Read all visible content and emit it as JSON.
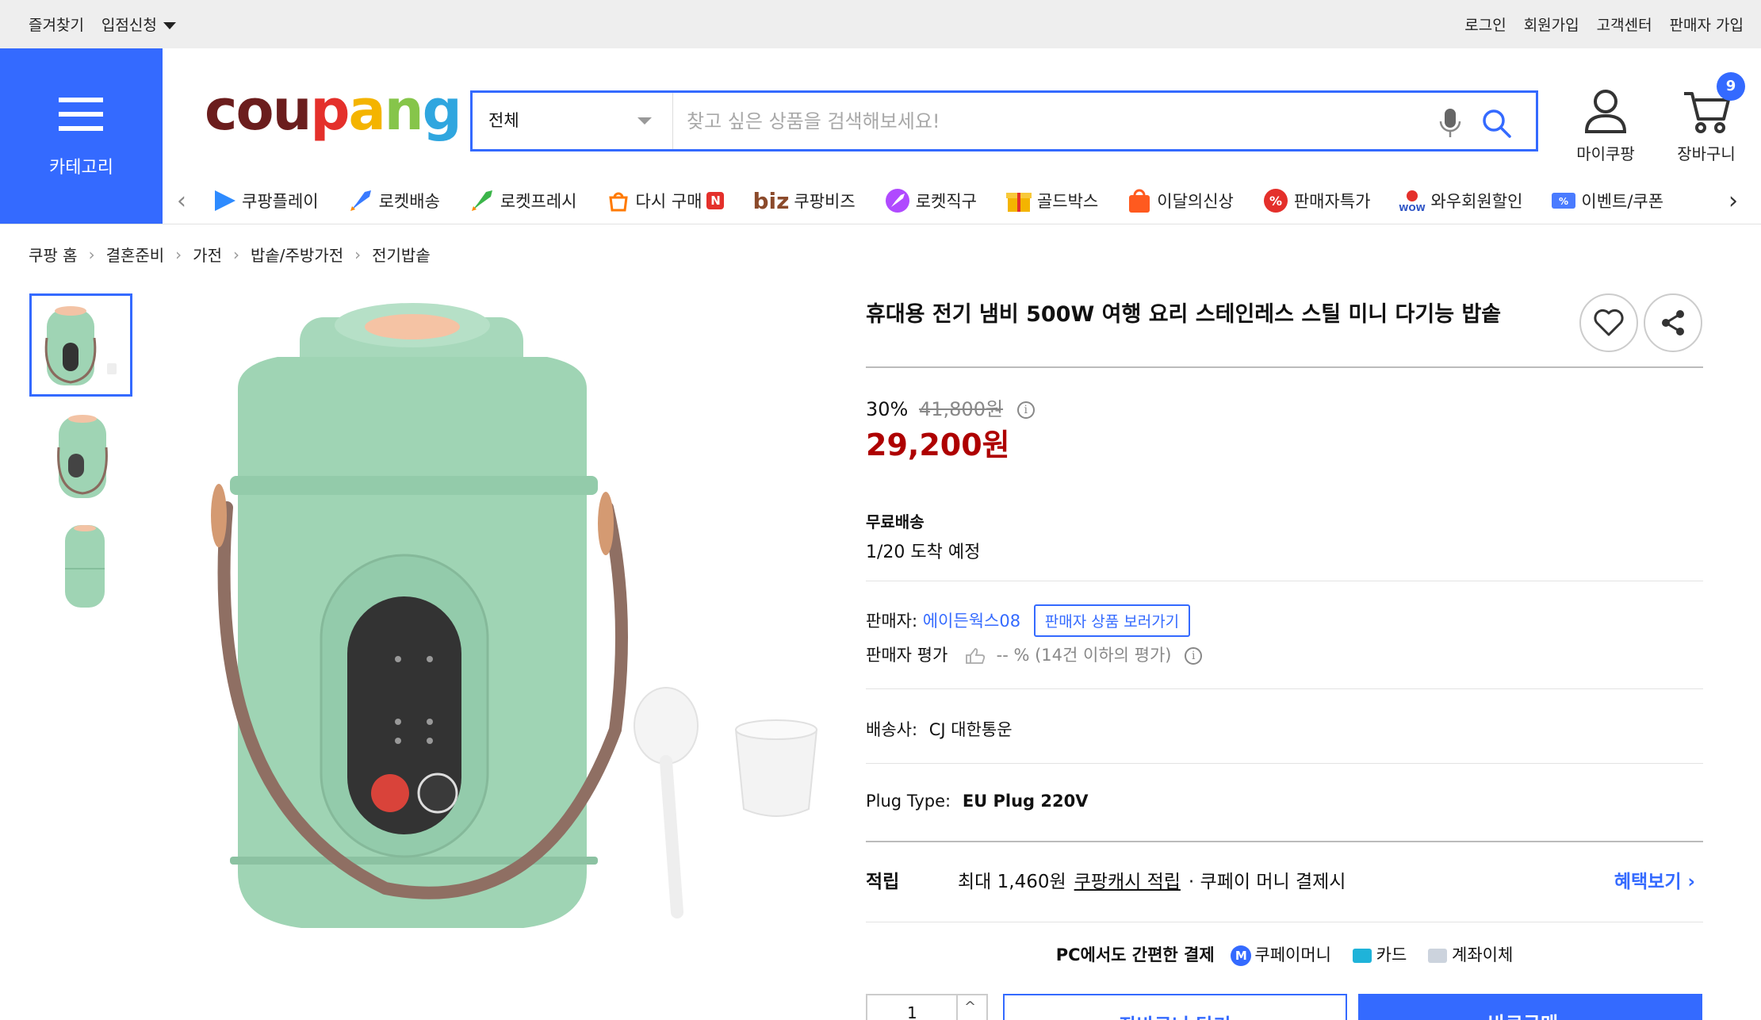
{
  "topbar": {
    "favorites": "즐겨찾기",
    "vendor_apply": "입점신청",
    "login": "로그인",
    "signup": "회원가입",
    "customer_center": "고객센터",
    "seller_join": "판매자 가입"
  },
  "header": {
    "category_label": "카테고리",
    "logo": {
      "c1": "cou",
      "c2": "p",
      "c3": "a",
      "c4": "n",
      "c5": "g"
    },
    "search_category": "전체",
    "search_placeholder": "찾고 싶은 상품을 검색해보세요!",
    "my_coupang": "마이쿠팡",
    "cart": "장바구니",
    "cart_count": "9"
  },
  "nav": {
    "items": [
      {
        "label": "쿠팡플레이",
        "icon": "play-icon",
        "color": "#2e8bff"
      },
      {
        "label": "로켓배송",
        "icon": "rocket-icon",
        "color": "#3a7bff"
      },
      {
        "label": "로켓프레시",
        "icon": "rocket-fresh-icon",
        "color": "#3bb54a"
      },
      {
        "label": "다시 구매",
        "icon": "repurchase-icon",
        "color": "#ff7a00"
      },
      {
        "label": "쿠팡비즈",
        "icon": "biz-icon",
        "color": "#8b4a2b"
      },
      {
        "label": "로켓직구",
        "icon": "rocket-direct-icon",
        "color": "#b04aff"
      },
      {
        "label": "골드박스",
        "icon": "goldbox-icon",
        "color": "#f4b400"
      },
      {
        "label": "이달의신상",
        "icon": "new-bag-icon",
        "color": "#ff5a1f"
      },
      {
        "label": "판매자특가",
        "icon": "percent-icon",
        "color": "#e4302b"
      },
      {
        "label": "와우회원할인",
        "icon": "wow-icon",
        "color": "#e4302b"
      },
      {
        "label": "이벤트/쿠폰",
        "icon": "coupon-icon",
        "color": "#4a7bff"
      }
    ],
    "biz_prefix": "biz",
    "repurchase_badge": "N"
  },
  "breadcrumb": [
    "쿠팡 홈",
    "결혼준비",
    "가전",
    "밥솥/주방가전",
    "전기밥솥"
  ],
  "product": {
    "title": "휴대용 전기 냄비 500W 여행 요리 스테인레스 스틸 미니 다기능 밥솥",
    "discount_rate": "30%",
    "original_price": "41,800원",
    "price": "29,200원",
    "shipping_label": "무료배송",
    "arrival": "1/20 도착 예정",
    "seller_label": "판매자:",
    "seller_name": "에이든웍스08",
    "seller_products_button": "판매자 상품 보러가기",
    "seller_rating_label": "판매자 평가",
    "seller_rating_value": "-- % (14건 이하의 평가)",
    "delivery_label": "배송사:",
    "delivery_company": "CJ 대한통운",
    "plug_label": "Plug Type:",
    "plug_value": "EU Plug 220V",
    "reward_label": "적립",
    "reward_text1": "최대 1,460원",
    "reward_link": "쿠팡캐시 적립",
    "reward_text2": "· 쿠페이 머니 결제시",
    "reward_more": "혜택보기 ›",
    "pay_title": "PC에서도 간편한 결제",
    "pay_money": "쿠페이머니",
    "pay_card": "카드",
    "pay_bank": "계좌이체",
    "pay_money_logo": "M",
    "quantity": "1",
    "cart_button": "장바구니 담기",
    "buy_button": "바로구매 ›"
  },
  "colors": {
    "accent": "#346aff",
    "price_red": "#ae0000",
    "product_green": "#9fd4b4"
  }
}
